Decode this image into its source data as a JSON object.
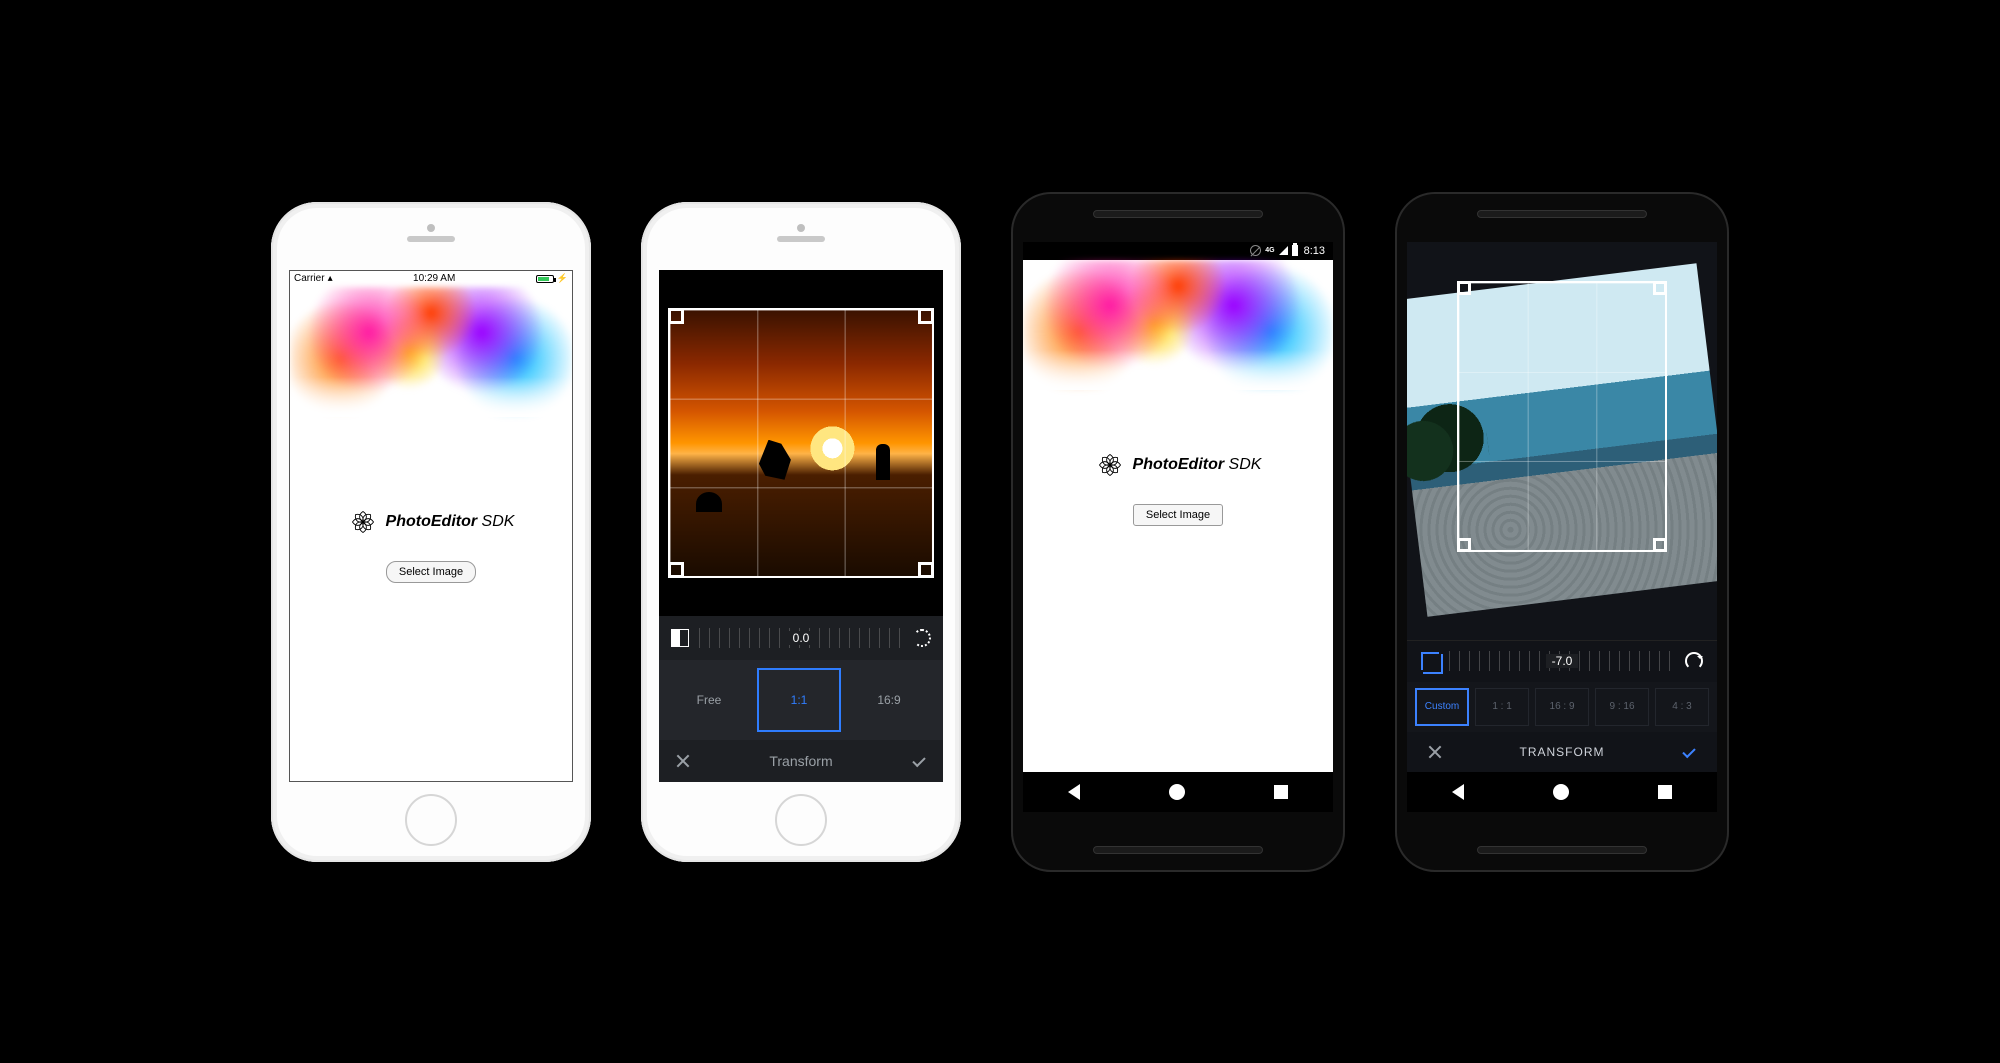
{
  "ios_status": {
    "carrier": "Carrier",
    "time": "10:29 AM",
    "battery_icon": "battery-charging"
  },
  "sdk": {
    "name_bold": "PhotoEditor",
    "name_rest": " SDK",
    "select_button": "Select Image"
  },
  "ios_transform": {
    "angle": "0.0",
    "ratios": [
      {
        "label": "Free",
        "selected": false
      },
      {
        "label": "1:1",
        "selected": true
      },
      {
        "label": "16:9",
        "selected": false
      }
    ],
    "title": "Transform"
  },
  "android_status": {
    "net_label": "4G",
    "time": "8:13"
  },
  "android_transform": {
    "angle": "-7.0",
    "ratios": [
      {
        "label": "Custom",
        "selected": true
      },
      {
        "label": "1 : 1",
        "selected": false
      },
      {
        "label": "16 : 9",
        "selected": false
      },
      {
        "label": "9 : 16",
        "selected": false
      },
      {
        "label": "4 : 3",
        "selected": false
      }
    ],
    "title": "TRANSFORM"
  }
}
